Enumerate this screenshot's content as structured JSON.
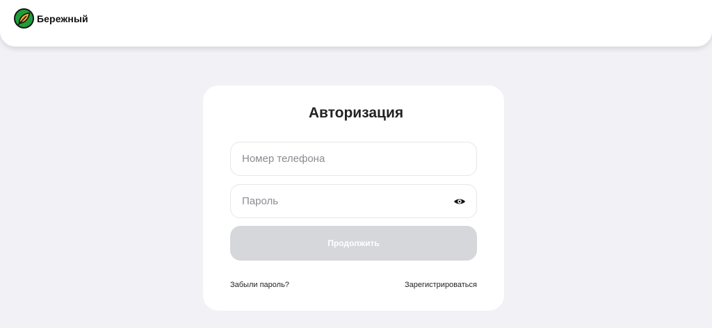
{
  "header": {
    "brand": "Бережный"
  },
  "auth": {
    "title": "Авторизация",
    "phone_placeholder": "Номер телефона",
    "phone_value": "",
    "password_placeholder": "Пароль",
    "password_value": "",
    "submit_label": "Продолжить",
    "forgot_label": "Забыли пароль?",
    "register_label": "Зарегистрироваться"
  },
  "icons": {
    "logo": "leaf-logo-icon",
    "password_toggle": "eye-icon"
  },
  "colors": {
    "page_background": "#f1f1f6",
    "brand_green": "#1f9d3a",
    "brand_dark": "#111111",
    "accent_orange": "#f5a623",
    "button_disabled": "#d6d7db"
  }
}
